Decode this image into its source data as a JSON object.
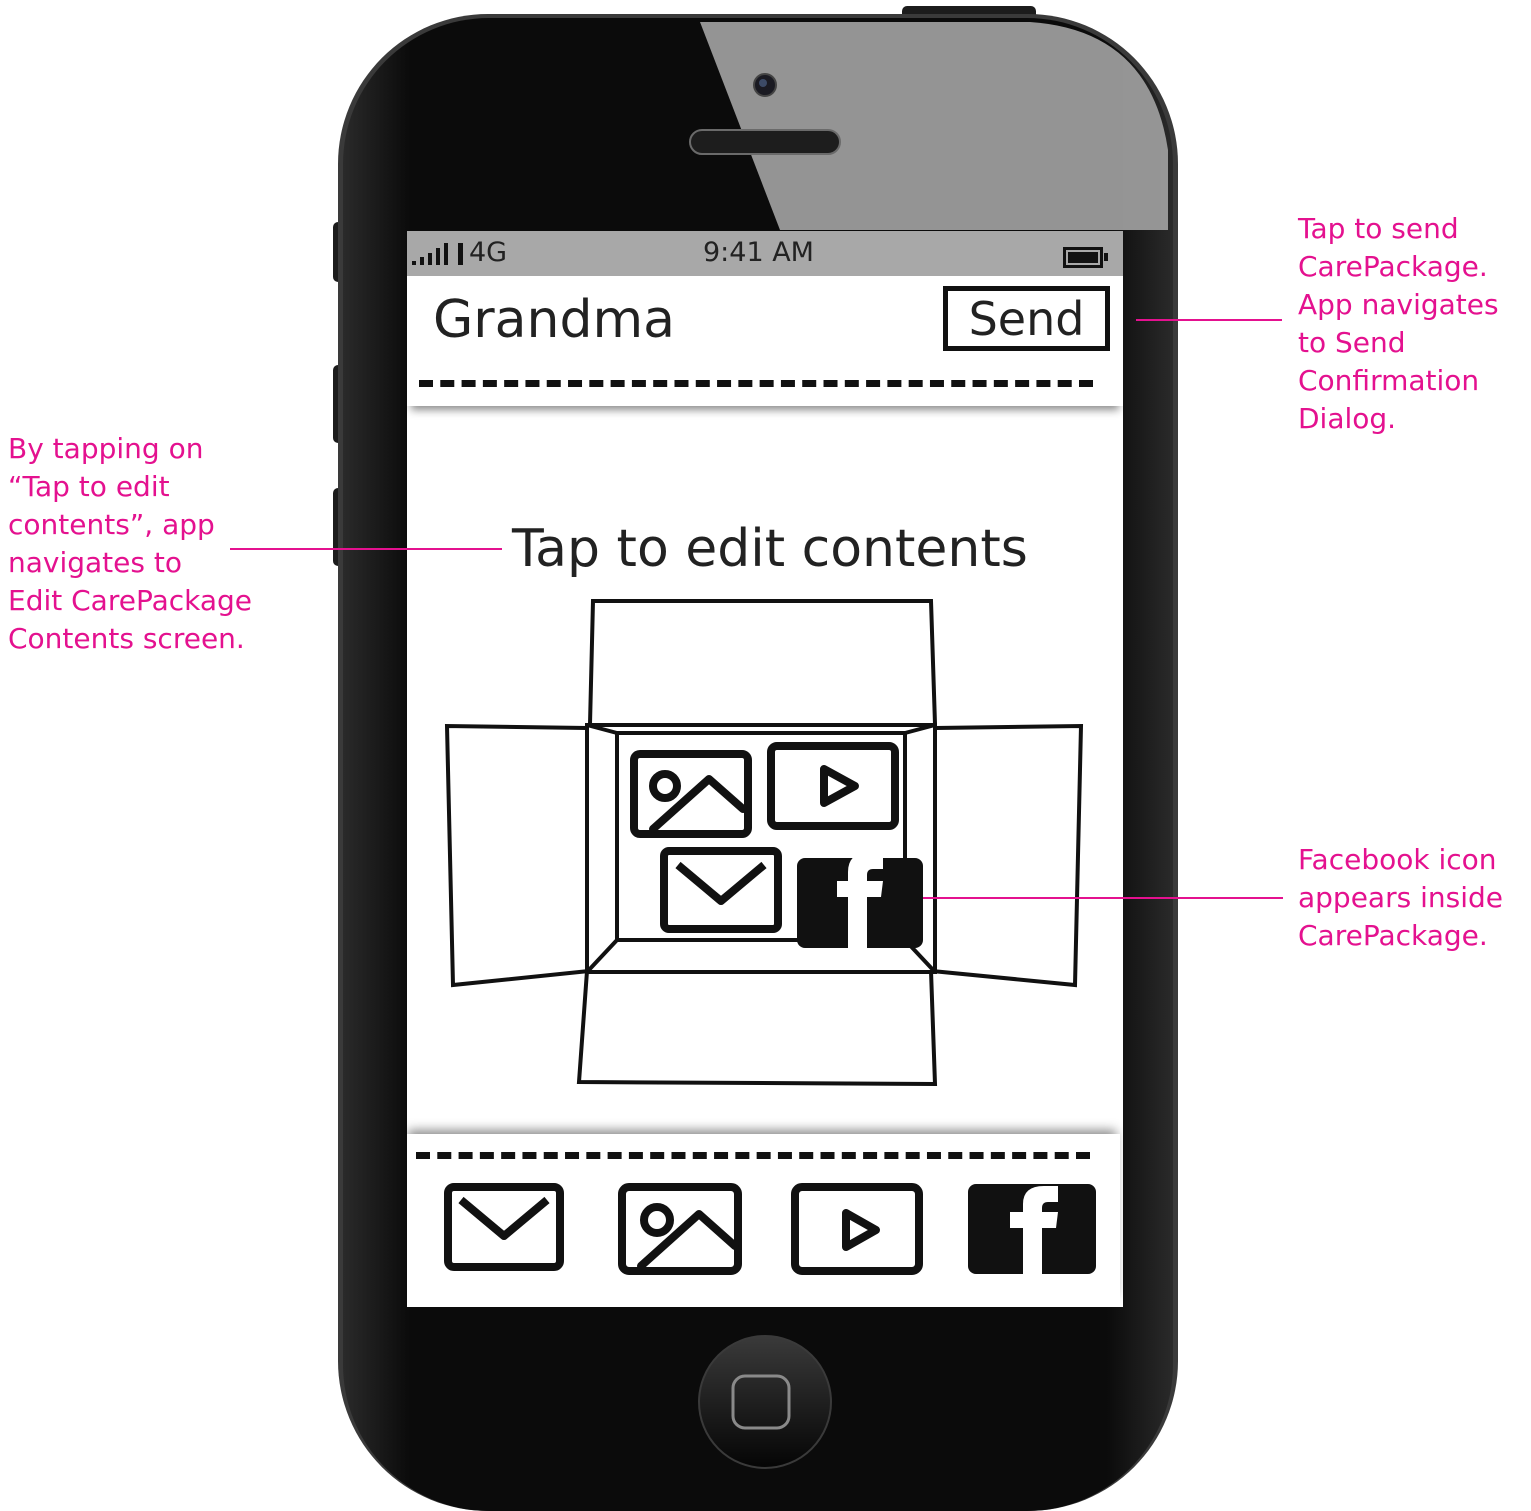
{
  "status_bar": {
    "network": "4G",
    "time": "9:41 AM"
  },
  "header": {
    "title": "Grandma",
    "send_label": "Send"
  },
  "main": {
    "edit_prompt": "Tap to edit contents"
  },
  "package_items": [
    "photo-icon",
    "video-icon",
    "mail-icon",
    "facebook-icon"
  ],
  "tray_items": [
    "mail-icon",
    "photo-icon",
    "video-icon",
    "facebook-icon"
  ],
  "annotations": {
    "send": "Tap to send\nCarePackage.\nApp navigates\nto Send\nConfirmation\nDialog.",
    "edit": "By tapping on\n“Tap to edit\ncontents”, app\nnavigates to\nEdit CarePackage\nContents screen.",
    "facebook": "Facebook icon\nappears inside\nCarePackage."
  },
  "colors": {
    "annotation": "#e4118f",
    "phone_body": "#0c0c0c",
    "status_bar": "#a8a8a8"
  }
}
